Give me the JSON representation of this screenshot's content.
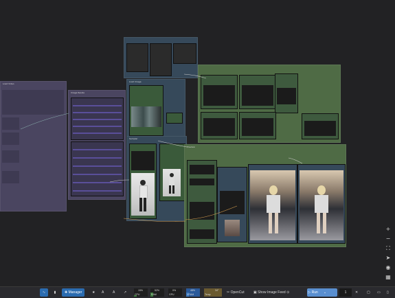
{
  "canvas": {
    "groups": [
      {
        "title": "Load Video"
      },
      {
        "title": "Image Resize"
      },
      {
        "title": "Load Image"
      },
      {
        "title": "Sampler"
      },
      {
        "title": "Preview"
      }
    ]
  },
  "toolbar": {
    "manager_label": "Manager",
    "cpu_label": "CPU",
    "cpu_value": "15%",
    "ram_label": "RAM",
    "ram_value": "52%",
    "gpu_label": "GPU",
    "gpu_value": "0%",
    "vram_label": "VRAM",
    "vram_value": "48%",
    "temp_label": "Temp",
    "temp_value": "34°",
    "opencut_label": "OpenCut",
    "show_feed_label": "Show Image Feed",
    "run_label": "Run",
    "queue_count": "1"
  },
  "colors": {
    "canvas_bg": "#222224",
    "group_purple": "#4a4560",
    "group_blue": "#36495a",
    "group_green": "#4f6b45",
    "accent_blue": "#2b6cb0"
  },
  "icons": [
    "comfy-logo-icon",
    "bookmark-icon",
    "puzzle-icon",
    "star-icon",
    "a-triangle-icon",
    "share-icon",
    "history-icon",
    "run-icon",
    "chevron-down-icon",
    "plus-icon",
    "minus-icon",
    "fit-view-icon",
    "send-icon",
    "eye-icon",
    "map-icon"
  ]
}
